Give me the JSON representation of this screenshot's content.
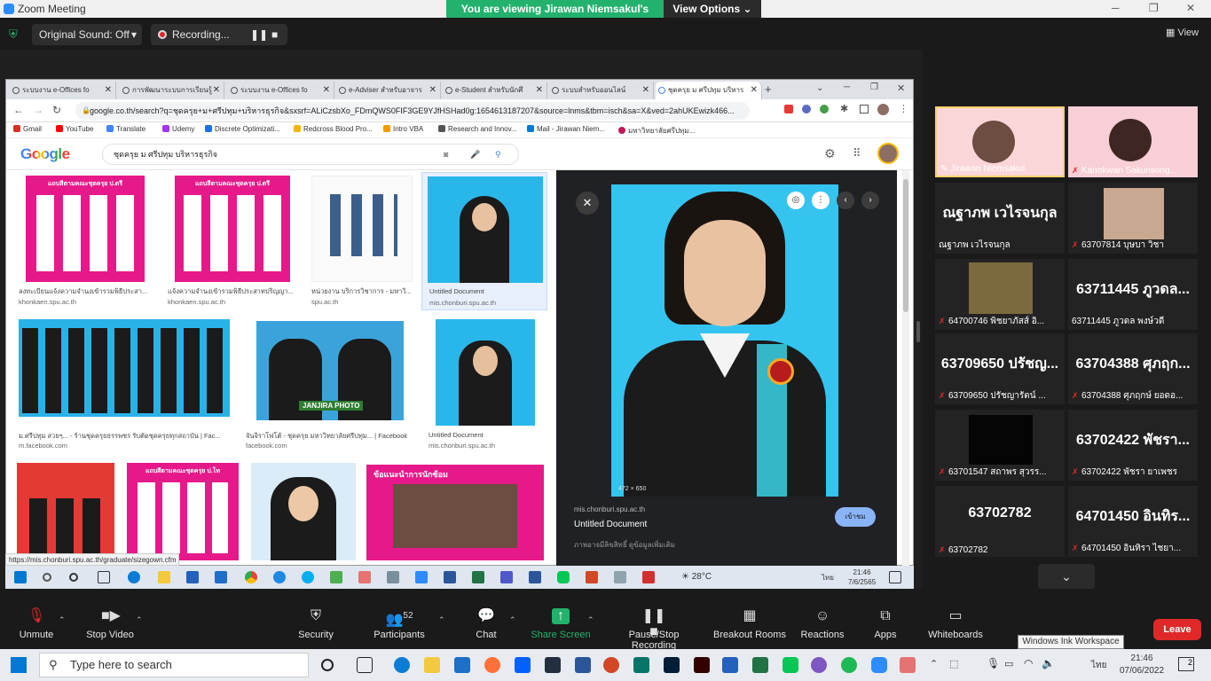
{
  "zoom": {
    "window_title": "Zoom Meeting",
    "viewing_banner": "You are viewing Jirawan Niemsakul's screen",
    "view_options": "View Options",
    "original_sound": "Original Sound: Off",
    "recording": "Recording...",
    "view_label": "View"
  },
  "chrome": {
    "tabs": [
      {
        "label": "ระบบงาน e-Offices fo"
      },
      {
        "label": "การพัฒนาระบบการเรียนรู้"
      },
      {
        "label": "ระบบงาน e-Offices fo"
      },
      {
        "label": "e-Adviser สำหรับอาจาร"
      },
      {
        "label": "e-Student สำหรับนักศึ"
      },
      {
        "label": "ระบบสำหรับออนไลน์"
      },
      {
        "label": "ชุดครุย ม ศรีปทุม บริหาร"
      }
    ],
    "url": "google.co.th/search?q=ชุดครุย+ม+ศรีปทุม+บริหารธุรกิจ&sxsrf=ALiCzsbXo_FDmQWS0FIF3GE9YJfHSHad0g:1654613187207&source=lnms&tbm=isch&sa=X&ved=2ahUKEwizk466...",
    "bookmarks": [
      {
        "label": "Gmail",
        "color": "#d93025"
      },
      {
        "label": "YouTube",
        "color": "#ff0000"
      },
      {
        "label": "Translate",
        "color": "#4285f4"
      },
      {
        "label": "Udemy",
        "color": "#a435f0"
      },
      {
        "label": "Discrete Optimizati...",
        "color": "#1a73e8"
      },
      {
        "label": "Redcross Blood Pro...",
        "color": "#f4b400"
      },
      {
        "label": "Intro VBA",
        "color": "#f29900"
      },
      {
        "label": "Research and Innov...",
        "color": "#555555"
      },
      {
        "label": "Mail - Jirawan Niem...",
        "color": "#0078d4"
      },
      {
        "label": "มหาวิทยาลัยศรีปทุม...",
        "color": "#c2185b"
      }
    ],
    "status_link": "https://mis.chonburi.spu.ac.th/graduate/sizegown.cfm"
  },
  "google": {
    "logo": "Google",
    "query": "ชุดครุย ม ศรีปทุม บริหารธุรกิจ",
    "results": [
      {
        "title": "ลงทะเบียนแจ้งความจำนงเข้ารวมพิธีประสา...",
        "source": "khonkaen.spu.ac.th",
        "card_text": "แถบสีตามคณะชุดครุย ป.ตรี"
      },
      {
        "title": "แจ้งความจำนงเข้ารวมพิธีประสาทปริญญา...",
        "source": "khonkaen.spu.ac.th",
        "card_text": "แถบสีตามคณะชุดครุย ป.ตรี"
      },
      {
        "title": "หน่วยงาน บริการวิชาการ - มหาวิ...",
        "source": "spu.ac.th"
      },
      {
        "title": "Untitled Document",
        "source": "mis.chonburi.spu.ac.th"
      },
      {
        "title": "ม.ศรีปทุม สวยๆ... - ร้านชุดครุยธรรพชร รับตัดชุดครุยทุกสถาบัน | Fac...",
        "source": "m.facebook.com"
      },
      {
        "title": "จันจิราโฟโต้ - ชุดครุย มหาวิทยาลัยศรีปทุม... | Facebook",
        "source": "facebook.com",
        "card_text": "JANJIRA PHOTO"
      },
      {
        "title": "Untitled Document",
        "source": "mis.chonburi.spu.ac.th"
      },
      {
        "card_text": "แถบสีตามคณะชุดครุย ป.โท"
      },
      {
        "card_text": "ข้อแนะนำการนักซ้อม"
      }
    ],
    "preview": {
      "source": "mis.chonburi.spu.ac.th",
      "title": "Untitled Document",
      "subtitle": "ภาพอาจมีลิขสิทธิ์ ดูข้อมูลเพิ่มเติม",
      "visit": "เข้าชม",
      "dimensions": "472 × 650"
    }
  },
  "share_taskbar": {
    "temp": "28°C",
    "time": "21:46",
    "date": "7/6/2565",
    "lang": "ไทย"
  },
  "participants": [
    {
      "name": "Jirawan Niemsakul",
      "big": ""
    },
    {
      "name": "Kanokwan Sakunsong...",
      "big": ""
    },
    {
      "name": "ณฐาภพ เวไรจนกุล",
      "big": "ณฐาภพ เวไรจนกุล"
    },
    {
      "name": "63707814 บุษบา วิชา",
      "big": ""
    },
    {
      "name": "64700746 พิชยาภัสส์ อิ...",
      "big": ""
    },
    {
      "name": "63711445 ภูวดล พงษ์วดี",
      "big": "63711445 ภูวดล..."
    },
    {
      "name": "63709650 ปรัชญารัตน์ ...",
      "big": "63709650 ปรัชญ..."
    },
    {
      "name": "63704388 ศุภฤกษ์ ยอดอ...",
      "big": "63704388 ศุภฤก..."
    },
    {
      "name": "63701547 สถาพร สุวรร...",
      "big": ""
    },
    {
      "name": "63702422 พัชรา ยาเพชร",
      "big": "63702422 พัชรา..."
    },
    {
      "name": "63702782",
      "big": "63702782"
    },
    {
      "name": "64701450 อินทิรา ไชยา...",
      "big": "64701450 อินทิร..."
    }
  ],
  "toolbar": {
    "unmute": "Unmute",
    "stop_video": "Stop Video",
    "security": "Security",
    "participants": "Participants",
    "participant_count": "52",
    "chat": "Chat",
    "share_screen": "Share Screen",
    "pause_recording": "Pause/Stop Recording",
    "breakout": "Breakout Rooms",
    "reactions": "Reactions",
    "apps": "Apps",
    "whiteboards": "Whiteboards",
    "leave": "Leave",
    "ink_tooltip": "Windows Ink Workspace"
  },
  "taskbar": {
    "search_placeholder": "Type here to search",
    "time": "21:46",
    "date": "07/06/2022",
    "lang": "ไทย",
    "notifications": "2"
  }
}
